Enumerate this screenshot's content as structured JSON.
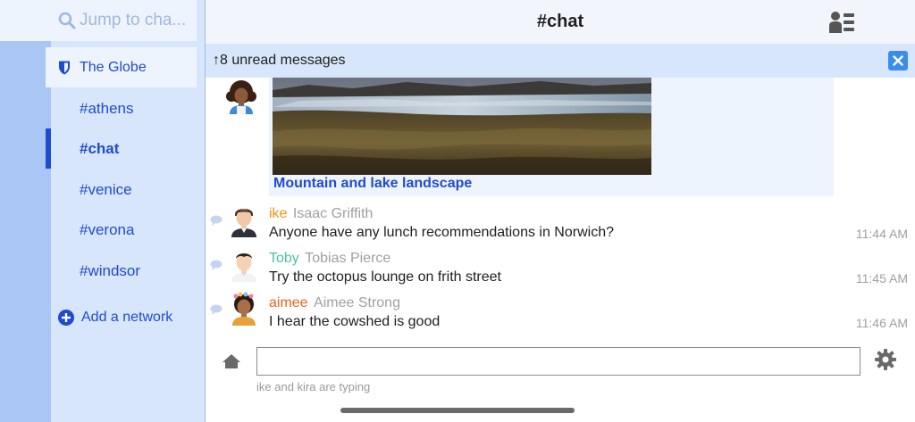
{
  "search": {
    "placeholder": "Jump to cha..."
  },
  "network": {
    "name": "The Globe"
  },
  "channels": [
    {
      "label": "#athens",
      "active": false
    },
    {
      "label": "#chat",
      "active": true
    },
    {
      "label": "#venice",
      "active": false
    },
    {
      "label": "#verona",
      "active": false
    },
    {
      "label": "#windsor",
      "active": false
    }
  ],
  "add_network": {
    "label": "Add a network"
  },
  "header": {
    "title": "#chat"
  },
  "unread": {
    "label": "↑8 unread messages"
  },
  "preview": {
    "title": "Mountain and lake landscape"
  },
  "messages": [
    {
      "nick": "ike",
      "nick_color": "#f2940f",
      "realname": "Isaac Griffith",
      "text": "Anyone have any lunch recommendations in Norwich?",
      "time": "11:44 AM"
    },
    {
      "nick": "Toby",
      "nick_color": "#4fc0a0",
      "realname": "Tobias Pierce",
      "text": "Try the octopus lounge on frith street",
      "time": "11:45 AM"
    },
    {
      "nick": "aimee",
      "nick_color": "#e0641e",
      "realname": "Aimee Strong",
      "text": "I hear the cowshed is good",
      "time": "11:46 AM"
    }
  ],
  "composer": {
    "value": "",
    "typing": "ike and kira are typing"
  },
  "colors": {
    "accent": "#1f4bd1",
    "sidebar": "#d8e6fb",
    "rail": "#a9c6f5",
    "close_button": "#3a8dec"
  },
  "icons": [
    "search-icon",
    "shield-icon",
    "plus-circle-icon",
    "members-icon",
    "close-icon",
    "chat-bubble-icon",
    "home-icon",
    "gear-icon"
  ]
}
